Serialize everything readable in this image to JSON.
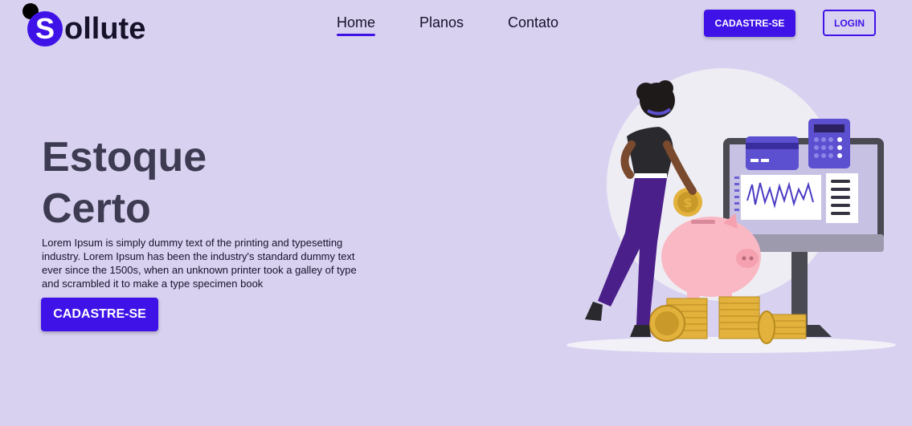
{
  "brand": {
    "logo_letter": "S",
    "logo_text": "ollute"
  },
  "nav": {
    "items": [
      {
        "label": "Home",
        "active": true
      },
      {
        "label": "Planos",
        "active": false
      },
      {
        "label": "Contato",
        "active": false
      }
    ]
  },
  "header": {
    "signup_label": "CADASTRE-SE",
    "login_label": "LOGIN"
  },
  "hero": {
    "title_line1": "Estoque",
    "title_line2": "Certo",
    "description": "Lorem Ipsum is simply dummy text of the printing and typesetting industry. Lorem Ipsum has been the industry's standard dummy text ever since the 1500s, when an unknown printer took a galley of type and scrambled it to make a type specimen book",
    "cta_label": "CADASTRE-SE"
  },
  "illustration": {
    "name": "woman-saving-money-piggy-bank",
    "coin_symbol": "$"
  },
  "colors": {
    "background": "#d9d1f0",
    "accent": "#3f13e8",
    "title": "#3d3b52"
  }
}
